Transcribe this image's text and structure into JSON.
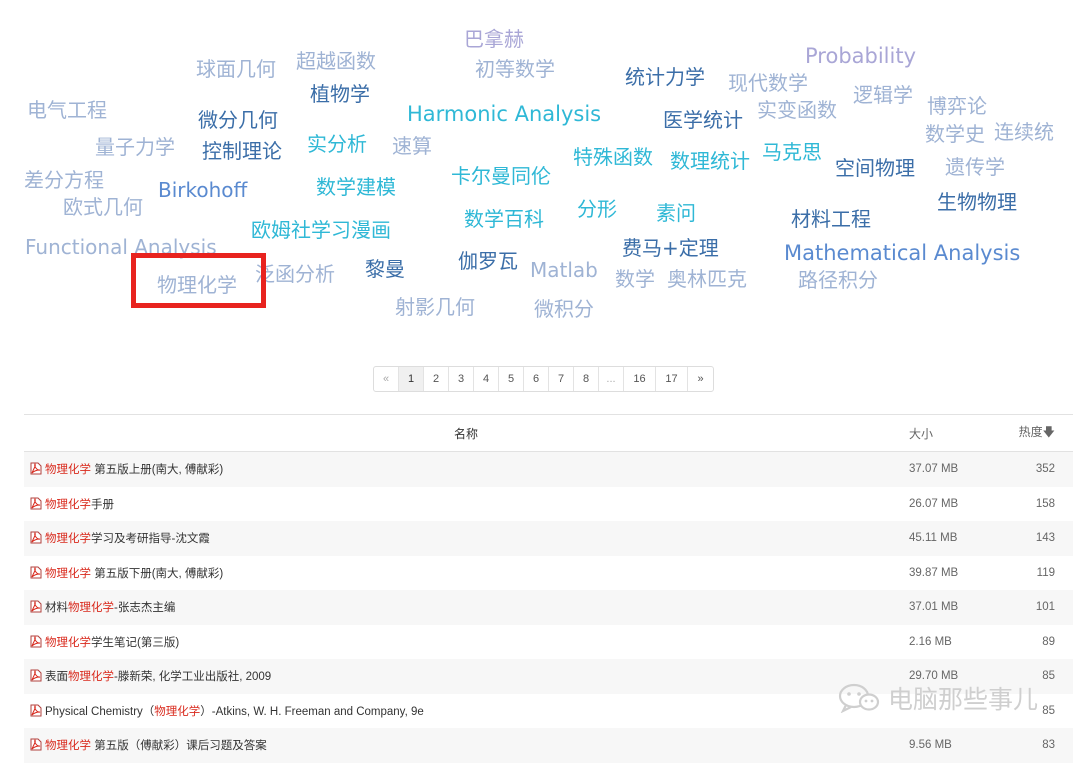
{
  "tag_cloud": {
    "tags": [
      {
        "text": "巴拿赫"
      },
      {
        "text": "Probability"
      },
      {
        "text": "球面几何"
      },
      {
        "text": "超越函数"
      },
      {
        "text": "初等数学"
      },
      {
        "text": "统计力学"
      },
      {
        "text": "现代数学"
      },
      {
        "text": "逻辑学"
      },
      {
        "text": "植物学"
      },
      {
        "text": "博弈论"
      },
      {
        "text": "电气工程"
      },
      {
        "text": "微分几何"
      },
      {
        "text": "Harmonic Analysis"
      },
      {
        "text": "医学统计"
      },
      {
        "text": "实变函数"
      },
      {
        "text": "数学史"
      },
      {
        "text": "连续统"
      },
      {
        "text": "量子力学"
      },
      {
        "text": "控制理论"
      },
      {
        "text": "实分析"
      },
      {
        "text": "速算"
      },
      {
        "text": "特殊函数"
      },
      {
        "text": "数理统计"
      },
      {
        "text": "马克思"
      },
      {
        "text": "空间物理"
      },
      {
        "text": "遗传学"
      },
      {
        "text": "差分方程"
      },
      {
        "text": "Birkohoff"
      },
      {
        "text": "数学建模"
      },
      {
        "text": "卡尔曼同伦"
      },
      {
        "text": "生物物理"
      },
      {
        "text": "欧式几何"
      },
      {
        "text": "分形"
      },
      {
        "text": "素问"
      },
      {
        "text": "材料工程"
      },
      {
        "text": "数学百科"
      },
      {
        "text": "欧姆社学习漫画"
      },
      {
        "text": "Functional Analysis"
      },
      {
        "text": "费马+定理"
      },
      {
        "text": "Mathematical Analysis"
      },
      {
        "text": "伽罗瓦"
      },
      {
        "text": "黎曼"
      },
      {
        "text": "泛函分析"
      },
      {
        "text": "物理化学"
      },
      {
        "text": "Matlab"
      },
      {
        "text": "数学"
      },
      {
        "text": "奥林匹克"
      },
      {
        "text": "路径积分"
      },
      {
        "text": "射影几何"
      },
      {
        "text": "微积分"
      }
    ]
  },
  "pagination": {
    "prev": "«",
    "next": "»",
    "pages": [
      "1",
      "2",
      "3",
      "4",
      "5",
      "6",
      "7",
      "8",
      "...",
      "16",
      "17"
    ],
    "current": "1"
  },
  "table": {
    "headers": {
      "name": "名称",
      "size": "大小",
      "heat": "热度",
      "sort_icon": "arrow-down-icon"
    },
    "keyword": "物理化学",
    "rows": [
      {
        "pre": "",
        "kw": "物理化学",
        "post": " 第五版上册(南大, 傅献彩)",
        "size": "37.07 MB",
        "heat": "352"
      },
      {
        "pre": "",
        "kw": "物理化学",
        "post": "手册",
        "size": "26.07 MB",
        "heat": "158"
      },
      {
        "pre": "",
        "kw": "物理化学",
        "post": "学习及考研指导-沈文霞",
        "size": "45.11 MB",
        "heat": "143"
      },
      {
        "pre": "",
        "kw": "物理化学",
        "post": " 第五版下册(南大, 傅献彩)",
        "size": "39.87 MB",
        "heat": "119"
      },
      {
        "pre": "材料",
        "kw": "物理化学",
        "post": "-张志杰主编",
        "size": "37.01 MB",
        "heat": "101"
      },
      {
        "pre": "",
        "kw": "物理化学",
        "post": "学生笔记(第三版)",
        "size": "2.16 MB",
        "heat": "89"
      },
      {
        "pre": "表面",
        "kw": "物理化学",
        "post": "-滕新荣, 化学工业出版社, 2009",
        "size": "29.70 MB",
        "heat": "85"
      },
      {
        "pre": "Physical Chemistry（",
        "kw": "物理化学",
        "post": "）-Atkins, W. H. Freeman and Company, 9e",
        "size": "",
        "heat": "85"
      },
      {
        "pre": "",
        "kw": "物理化学",
        "post": " 第五版（傅献彩）课后习题及答案",
        "size": "9.56 MB",
        "heat": "83"
      }
    ]
  },
  "watermark": {
    "text": "电脑那些事儿",
    "icon": "wechat-icon"
  },
  "colors": {
    "highlight_box": "#e8231f",
    "keyword": "#d9291c"
  }
}
